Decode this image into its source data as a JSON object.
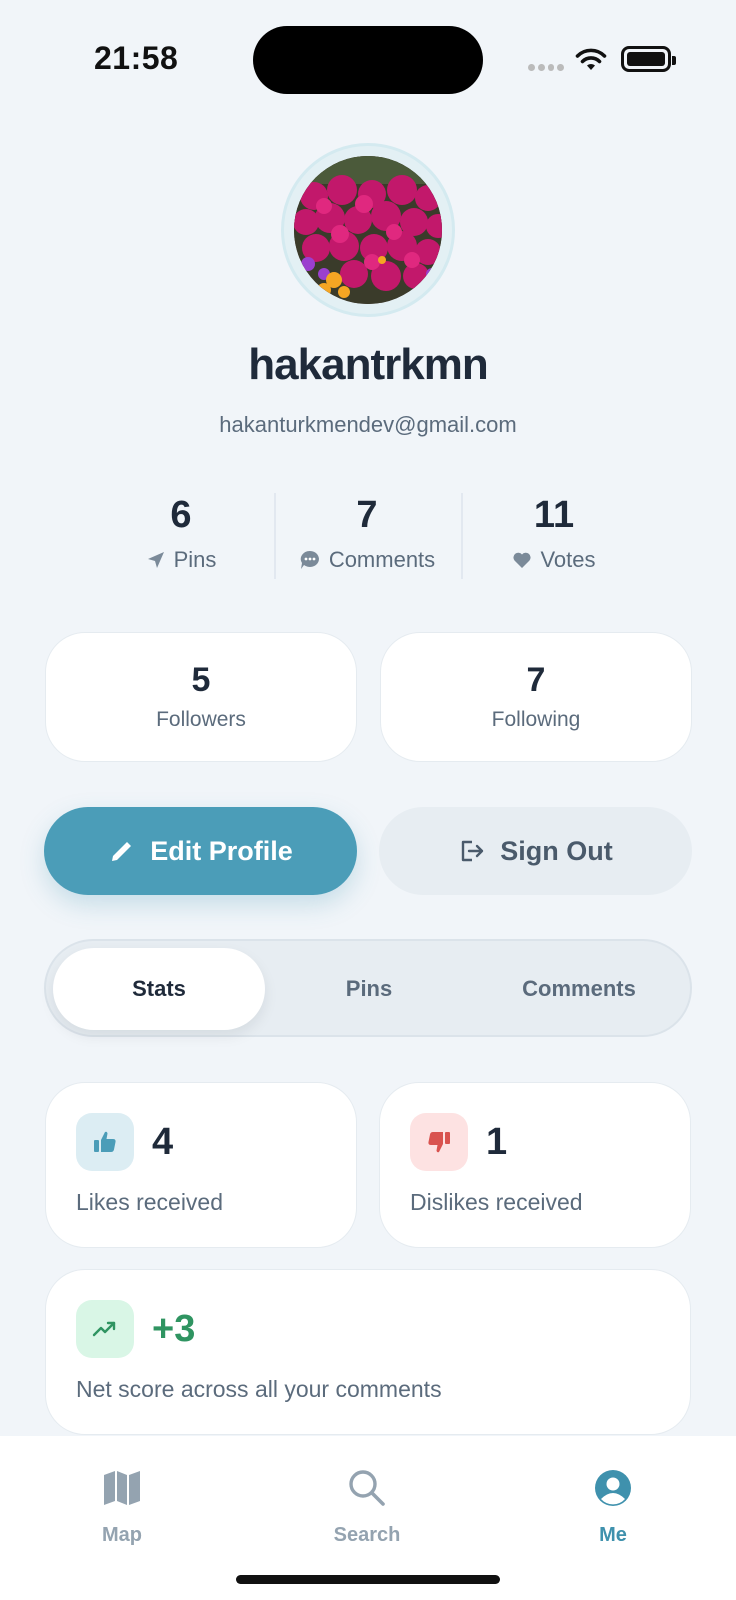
{
  "status_bar": {
    "time": "21:58"
  },
  "profile": {
    "username": "hakantrkmn",
    "email": "hakanturkmendev@gmail.com"
  },
  "summary": [
    {
      "value": "6",
      "label": "Pins",
      "icon": "location-arrow-icon"
    },
    {
      "value": "7",
      "label": "Comments",
      "icon": "chat-bubble-icon"
    },
    {
      "value": "11",
      "label": "Votes",
      "icon": "heart-icon"
    }
  ],
  "social": {
    "followers": {
      "value": "5",
      "label": "Followers"
    },
    "following": {
      "value": "7",
      "label": "Following"
    }
  },
  "actions": {
    "edit_profile": "Edit Profile",
    "sign_out": "Sign Out"
  },
  "tabs": [
    {
      "label": "Stats",
      "active": true
    },
    {
      "label": "Pins",
      "active": false
    },
    {
      "label": "Comments",
      "active": false
    }
  ],
  "stats": {
    "likes": {
      "value": "4",
      "label": "Likes received",
      "icon": "thumbs-up-icon"
    },
    "dislikes": {
      "value": "1",
      "label": "Dislikes received",
      "icon": "thumbs-down-icon"
    },
    "net_score": {
      "value": "+3",
      "label": "Net score across all your comments",
      "icon": "trending-up-icon"
    }
  },
  "nav": [
    {
      "label": "Map",
      "icon": "map-icon",
      "active": false
    },
    {
      "label": "Search",
      "icon": "search-icon",
      "active": false
    },
    {
      "label": "Me",
      "icon": "profile-icon",
      "active": true
    }
  ],
  "colors": {
    "accent": "#4b9db8",
    "background": "#f1f5f9",
    "positive": "#2f9461",
    "negative": "#d9534f"
  }
}
